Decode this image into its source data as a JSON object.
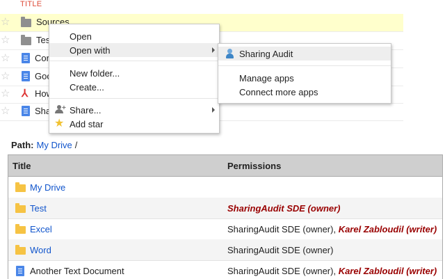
{
  "drive_list": {
    "column_title": "TITLE",
    "rows": [
      {
        "name": "Sources",
        "icon": "folder-icon"
      },
      {
        "name": "Test",
        "icon": "folder-icon"
      },
      {
        "name": "Cor",
        "icon": "document-icon"
      },
      {
        "name": "Goo",
        "icon": "document-icon"
      },
      {
        "name": "How",
        "icon": "pdf-icon"
      },
      {
        "name": "Sha",
        "icon": "document-icon"
      }
    ]
  },
  "context_menu": {
    "open": "Open",
    "open_with": "Open with",
    "new_folder": "New folder...",
    "create": "Create...",
    "share": "Share...",
    "add_star": "Add star"
  },
  "submenu": {
    "sharing_audit": "Sharing Audit",
    "manage_apps": "Manage apps",
    "connect_more_apps": "Connect more apps"
  },
  "path": {
    "label": "Path:",
    "link": "My Drive",
    "separator": "/"
  },
  "table": {
    "headers": {
      "title": "Title",
      "permissions": "Permissions"
    },
    "rows": [
      {
        "title": "My Drive",
        "perm_plain": "",
        "perm_owner": "",
        "perm_writer": ""
      },
      {
        "title": "Test",
        "perm_plain": "",
        "perm_owner": "SharingAudit SDE (owner)",
        "perm_writer": ""
      },
      {
        "title": "Excel",
        "perm_plain": "SharingAudit SDE (owner), ",
        "perm_owner": "",
        "perm_writer": "Karel Zabloudil (writer)"
      },
      {
        "title": "Word",
        "perm_plain": "SharingAudit SDE (owner)",
        "perm_owner": "",
        "perm_writer": ""
      },
      {
        "title": "Another Text Document",
        "perm_plain": "SharingAudit SDE (owner), ",
        "perm_owner": "",
        "perm_writer": "Karel Zabloudil (writer)"
      }
    ]
  },
  "colors": {
    "title_red": "#dd4b39",
    "selected_row": "#ffffcc",
    "link_blue": "#1155cc",
    "emphasis_red": "#990000",
    "folder_yellow": "#f6c344",
    "doc_blue": "#4a86e8"
  }
}
